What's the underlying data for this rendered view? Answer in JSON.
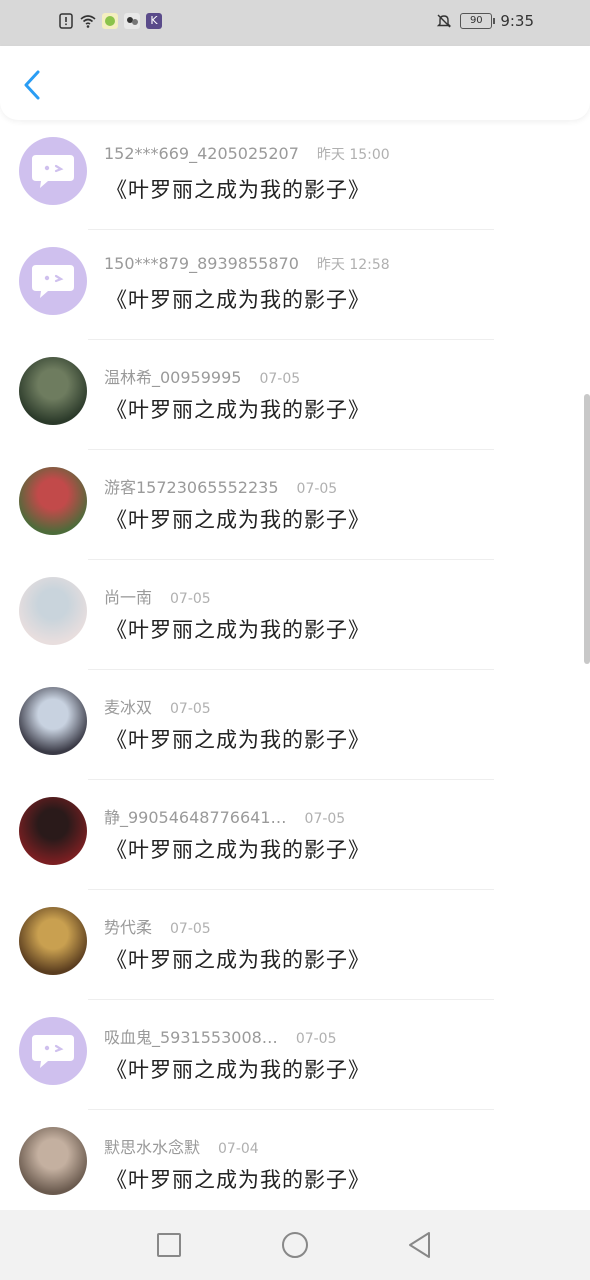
{
  "status_bar": {
    "battery": "90",
    "time": "9:35"
  },
  "header": {
    "back_icon": "chevron-left-icon"
  },
  "messages": [
    {
      "name": "152***669_4205025207",
      "time": "昨天 15:00",
      "text": "《叶罗丽之成为我的影子》",
      "avatar": "default"
    },
    {
      "name": "150***879_8939855870",
      "time": "昨天 12:58",
      "text": "《叶罗丽之成为我的影子》",
      "avatar": "default"
    },
    {
      "name": "温林希_00959995",
      "time": "07-05",
      "text": "《叶罗丽之成为我的影子》",
      "avatar": "photo"
    },
    {
      "name": "游客15723065552235",
      "time": "07-05",
      "text": "《叶罗丽之成为我的影子》",
      "avatar": "photo"
    },
    {
      "name": "尚一南",
      "time": "07-05",
      "text": "《叶罗丽之成为我的影子》",
      "avatar": "photo"
    },
    {
      "name": "麦冰双",
      "time": "07-05",
      "text": "《叶罗丽之成为我的影子》",
      "avatar": "photo"
    },
    {
      "name": "静_99054648776641…",
      "time": "07-05",
      "text": "《叶罗丽之成为我的影子》",
      "avatar": "photo"
    },
    {
      "name": "势代柔",
      "time": "07-05",
      "text": "《叶罗丽之成为我的影子》",
      "avatar": "photo"
    },
    {
      "name": "吸血鬼_5931553008…",
      "time": "07-05",
      "text": "《叶罗丽之成为我的影子》",
      "avatar": "default"
    },
    {
      "name": "默思水水念默",
      "time": "07-04",
      "text": "《叶罗丽之成为我的影子》",
      "avatar": "photo"
    }
  ],
  "colors": {
    "accent": "#2a9df4",
    "default_avatar": "#cfc0ee"
  },
  "nav": {
    "square_icon": "recent-apps-icon",
    "circle_icon": "home-icon",
    "triangle_icon": "back-triangle-icon"
  }
}
